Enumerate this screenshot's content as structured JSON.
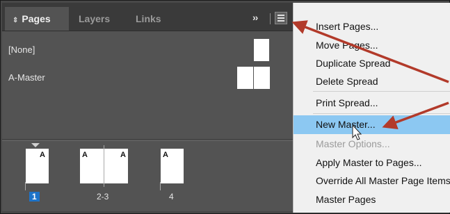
{
  "panel": {
    "tabs": [
      {
        "label": "Pages",
        "active": true
      },
      {
        "label": "Layers",
        "active": false
      },
      {
        "label": "Links",
        "active": false
      }
    ],
    "overflow_glyph": "››",
    "masters": [
      {
        "label": "[None]"
      },
      {
        "label": "A-Master"
      }
    ],
    "page_master_letter": "A",
    "page_numbers": [
      "1",
      "2-3",
      "4"
    ]
  },
  "menu": {
    "items": [
      {
        "label": "Insert Pages...",
        "state": "normal"
      },
      {
        "label": "Move Pages...",
        "state": "normal"
      },
      {
        "label": "Duplicate Spread",
        "state": "normal"
      },
      {
        "label": "Delete Spread",
        "state": "normal"
      },
      {
        "label": "Print Spread...",
        "state": "normal"
      },
      {
        "label": "New Master...",
        "state": "highlighted"
      },
      {
        "label": "Master Options...",
        "state": "disabled"
      },
      {
        "label": "Apply Master to Pages...",
        "state": "normal"
      },
      {
        "label": "Override All Master Page Items",
        "state": "normal"
      },
      {
        "label": "Master Pages",
        "state": "normal"
      }
    ]
  },
  "colors": {
    "panel_bg": "#535353",
    "menu_bg": "#f0f0f0",
    "highlight": "#8cc8f2",
    "selected_page_badge": "#1e73c8",
    "annotation_arrow": "#b23a2a"
  }
}
